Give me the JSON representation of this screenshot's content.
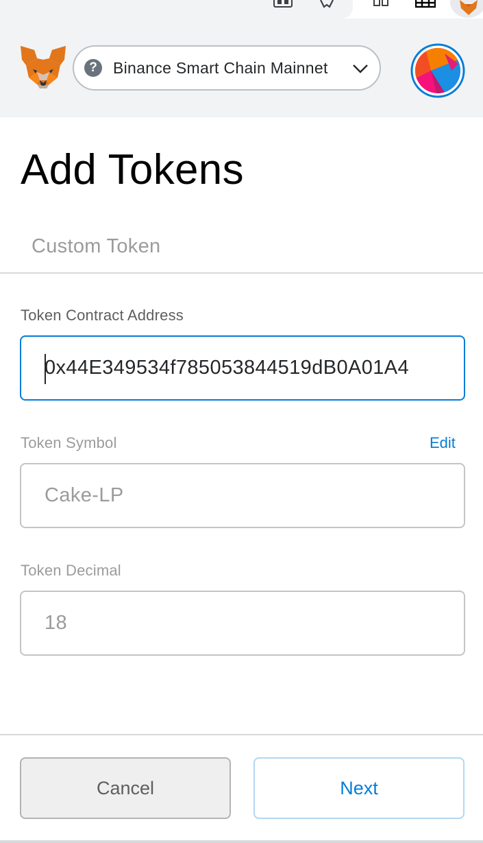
{
  "header": {
    "network_label": "Binance Smart Chain Mainnet",
    "help_glyph": "?",
    "icons": [
      "metamask-fox-icon",
      "help-circle-icon",
      "chevron-down-icon",
      "account-avatar-icon"
    ]
  },
  "page": {
    "title": "Add Tokens",
    "tab_custom": "Custom Token"
  },
  "form": {
    "address_label": "Token Contract Address",
    "address_value": "0x44E349534f785053844519dB0A01A4",
    "symbol_label": "Token Symbol",
    "symbol_edit": "Edit",
    "symbol_value": "Cake-LP",
    "decimal_label": "Token Decimal",
    "decimal_value": "18"
  },
  "footer": {
    "cancel_label": "Cancel",
    "next_label": "Next"
  },
  "colors": {
    "accent": "#037dd6",
    "header_bg": "#f2f3f4",
    "fox_orange": "#e2761b"
  }
}
